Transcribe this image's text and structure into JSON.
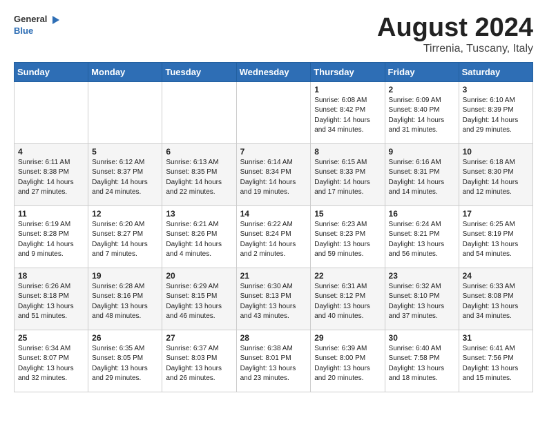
{
  "header": {
    "logo_general": "General",
    "logo_blue": "Blue",
    "month_year": "August 2024",
    "location": "Tirrenia, Tuscany, Italy"
  },
  "weekdays": [
    "Sunday",
    "Monday",
    "Tuesday",
    "Wednesday",
    "Thursday",
    "Friday",
    "Saturday"
  ],
  "weeks": [
    [
      {
        "day": "",
        "info": ""
      },
      {
        "day": "",
        "info": ""
      },
      {
        "day": "",
        "info": ""
      },
      {
        "day": "",
        "info": ""
      },
      {
        "day": "1",
        "info": "Sunrise: 6:08 AM\nSunset: 8:42 PM\nDaylight: 14 hours\nand 34 minutes."
      },
      {
        "day": "2",
        "info": "Sunrise: 6:09 AM\nSunset: 8:40 PM\nDaylight: 14 hours\nand 31 minutes."
      },
      {
        "day": "3",
        "info": "Sunrise: 6:10 AM\nSunset: 8:39 PM\nDaylight: 14 hours\nand 29 minutes."
      }
    ],
    [
      {
        "day": "4",
        "info": "Sunrise: 6:11 AM\nSunset: 8:38 PM\nDaylight: 14 hours\nand 27 minutes."
      },
      {
        "day": "5",
        "info": "Sunrise: 6:12 AM\nSunset: 8:37 PM\nDaylight: 14 hours\nand 24 minutes."
      },
      {
        "day": "6",
        "info": "Sunrise: 6:13 AM\nSunset: 8:35 PM\nDaylight: 14 hours\nand 22 minutes."
      },
      {
        "day": "7",
        "info": "Sunrise: 6:14 AM\nSunset: 8:34 PM\nDaylight: 14 hours\nand 19 minutes."
      },
      {
        "day": "8",
        "info": "Sunrise: 6:15 AM\nSunset: 8:33 PM\nDaylight: 14 hours\nand 17 minutes."
      },
      {
        "day": "9",
        "info": "Sunrise: 6:16 AM\nSunset: 8:31 PM\nDaylight: 14 hours\nand 14 minutes."
      },
      {
        "day": "10",
        "info": "Sunrise: 6:18 AM\nSunset: 8:30 PM\nDaylight: 14 hours\nand 12 minutes."
      }
    ],
    [
      {
        "day": "11",
        "info": "Sunrise: 6:19 AM\nSunset: 8:28 PM\nDaylight: 14 hours\nand 9 minutes."
      },
      {
        "day": "12",
        "info": "Sunrise: 6:20 AM\nSunset: 8:27 PM\nDaylight: 14 hours\nand 7 minutes."
      },
      {
        "day": "13",
        "info": "Sunrise: 6:21 AM\nSunset: 8:26 PM\nDaylight: 14 hours\nand 4 minutes."
      },
      {
        "day": "14",
        "info": "Sunrise: 6:22 AM\nSunset: 8:24 PM\nDaylight: 14 hours\nand 2 minutes."
      },
      {
        "day": "15",
        "info": "Sunrise: 6:23 AM\nSunset: 8:23 PM\nDaylight: 13 hours\nand 59 minutes."
      },
      {
        "day": "16",
        "info": "Sunrise: 6:24 AM\nSunset: 8:21 PM\nDaylight: 13 hours\nand 56 minutes."
      },
      {
        "day": "17",
        "info": "Sunrise: 6:25 AM\nSunset: 8:19 PM\nDaylight: 13 hours\nand 54 minutes."
      }
    ],
    [
      {
        "day": "18",
        "info": "Sunrise: 6:26 AM\nSunset: 8:18 PM\nDaylight: 13 hours\nand 51 minutes."
      },
      {
        "day": "19",
        "info": "Sunrise: 6:28 AM\nSunset: 8:16 PM\nDaylight: 13 hours\nand 48 minutes."
      },
      {
        "day": "20",
        "info": "Sunrise: 6:29 AM\nSunset: 8:15 PM\nDaylight: 13 hours\nand 46 minutes."
      },
      {
        "day": "21",
        "info": "Sunrise: 6:30 AM\nSunset: 8:13 PM\nDaylight: 13 hours\nand 43 minutes."
      },
      {
        "day": "22",
        "info": "Sunrise: 6:31 AM\nSunset: 8:12 PM\nDaylight: 13 hours\nand 40 minutes."
      },
      {
        "day": "23",
        "info": "Sunrise: 6:32 AM\nSunset: 8:10 PM\nDaylight: 13 hours\nand 37 minutes."
      },
      {
        "day": "24",
        "info": "Sunrise: 6:33 AM\nSunset: 8:08 PM\nDaylight: 13 hours\nand 34 minutes."
      }
    ],
    [
      {
        "day": "25",
        "info": "Sunrise: 6:34 AM\nSunset: 8:07 PM\nDaylight: 13 hours\nand 32 minutes."
      },
      {
        "day": "26",
        "info": "Sunrise: 6:35 AM\nSunset: 8:05 PM\nDaylight: 13 hours\nand 29 minutes."
      },
      {
        "day": "27",
        "info": "Sunrise: 6:37 AM\nSunset: 8:03 PM\nDaylight: 13 hours\nand 26 minutes."
      },
      {
        "day": "28",
        "info": "Sunrise: 6:38 AM\nSunset: 8:01 PM\nDaylight: 13 hours\nand 23 minutes."
      },
      {
        "day": "29",
        "info": "Sunrise: 6:39 AM\nSunset: 8:00 PM\nDaylight: 13 hours\nand 20 minutes."
      },
      {
        "day": "30",
        "info": "Sunrise: 6:40 AM\nSunset: 7:58 PM\nDaylight: 13 hours\nand 18 minutes."
      },
      {
        "day": "31",
        "info": "Sunrise: 6:41 AM\nSunset: 7:56 PM\nDaylight: 13 hours\nand 15 minutes."
      }
    ]
  ]
}
